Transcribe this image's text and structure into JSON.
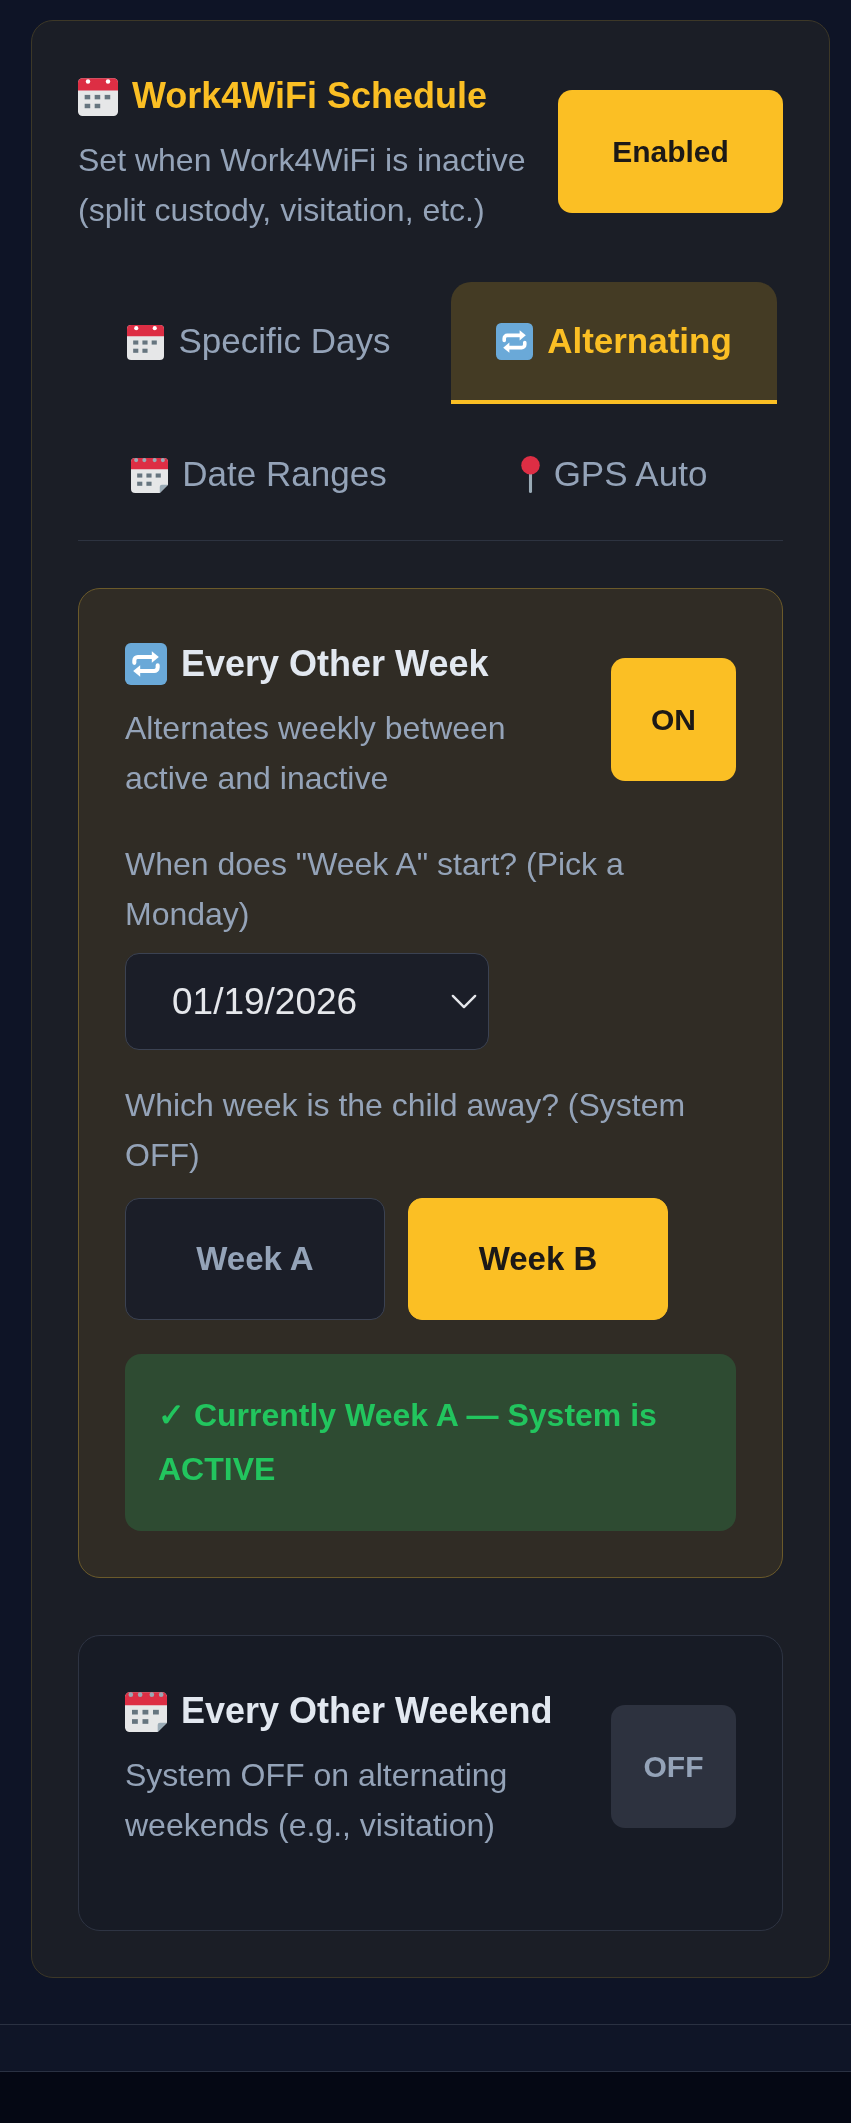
{
  "schedule": {
    "title": "Work4WiFi Schedule",
    "description": "Set when Work4WiFi is inactive (split custody, visitation, etc.)",
    "toggle": {
      "label": "Enabled",
      "on": true
    }
  },
  "tabs": [
    {
      "label": "Specific Days",
      "selected": false
    },
    {
      "label": "Alternating",
      "selected": true
    },
    {
      "label": "Date Ranges",
      "selected": false
    },
    {
      "label": "GPS Auto",
      "selected": false
    }
  ],
  "cards": [
    {
      "title": "Every Other Week",
      "description": "Alternates weekly between active and inactive",
      "toggle": {
        "label": "ON",
        "on": true
      },
      "start_label": "When does \"Week A\" start? (Pick a Monday)",
      "start_date": {
        "value": "01/19/2026"
      },
      "away_label": "Which week is the child away? (System OFF)",
      "weeks": [
        {
          "label": "Week A",
          "selected": false
        },
        {
          "label": "Week B",
          "selected": true
        }
      ],
      "status": "✓ Currently Week A — System is ACTIVE"
    },
    {
      "title": "Every Other Weekend",
      "description": "System OFF on alternating weekends (e.g., visitation)",
      "toggle": {
        "label": "OFF",
        "on": false
      }
    }
  ]
}
